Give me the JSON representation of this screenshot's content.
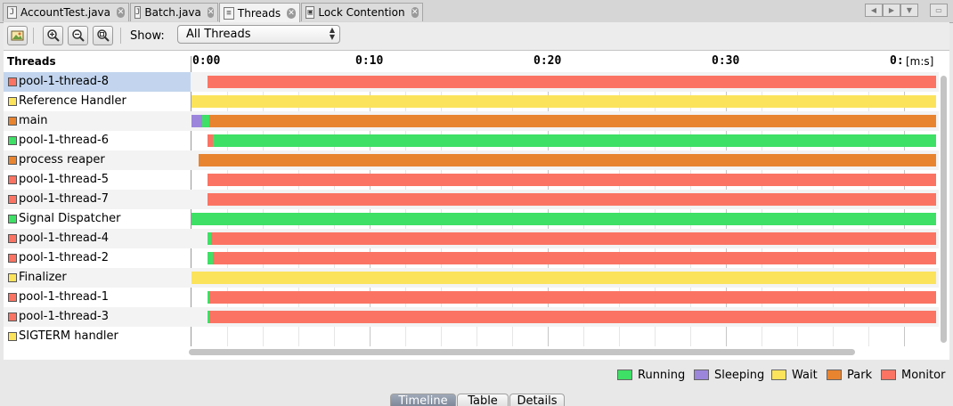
{
  "tabs": [
    {
      "label": "AccountTest.java",
      "icon": "java-file-icon"
    },
    {
      "label": "Batch.java",
      "icon": "java-file-icon"
    },
    {
      "label": "Threads",
      "icon": "threads-icon"
    },
    {
      "label": "Lock Contention",
      "icon": "lock-icon"
    }
  ],
  "toolbar": {
    "show_label": "Show:",
    "show_value": "All Threads"
  },
  "timeline": {
    "header_label": "Threads",
    "ticks": [
      "0:00",
      "0:10",
      "0:20",
      "0:30",
      "0:"
    ],
    "unit": "[m:s]"
  },
  "states": {
    "Running": "#3ee065",
    "Sleeping": "#9b86dc",
    "Wait": "#fbe35c",
    "Park": "#e88430",
    "Monitor": "#fb7463"
  },
  "threads": [
    {
      "name": "pool-1-thread-8",
      "state": "Monitor",
      "selected": true,
      "segments": [
        {
          "state": "Monitor",
          "from": 0.9,
          "to": 41.8
        }
      ]
    },
    {
      "name": "Reference Handler",
      "state": "Wait",
      "segments": [
        {
          "state": "Wait",
          "from": 0.0,
          "to": 41.8
        }
      ]
    },
    {
      "name": "main",
      "state": "Park",
      "segments": [
        {
          "state": "Sleeping",
          "from": 0.0,
          "to": 0.6
        },
        {
          "state": "Running",
          "from": 0.6,
          "to": 1.0
        },
        {
          "state": "Park",
          "from": 1.0,
          "to": 41.8
        }
      ]
    },
    {
      "name": "pool-1-thread-6",
      "state": "Running",
      "segments": [
        {
          "state": "Monitor",
          "from": 0.9,
          "to": 1.2
        },
        {
          "state": "Running",
          "from": 1.2,
          "to": 41.8
        }
      ]
    },
    {
      "name": "process reaper",
      "state": "Park",
      "segments": [
        {
          "state": "Park",
          "from": 0.4,
          "to": 41.8
        }
      ]
    },
    {
      "name": "pool-1-thread-5",
      "state": "Monitor",
      "segments": [
        {
          "state": "Monitor",
          "from": 0.9,
          "to": 41.8
        }
      ]
    },
    {
      "name": "pool-1-thread-7",
      "state": "Monitor",
      "segments": [
        {
          "state": "Monitor",
          "from": 0.9,
          "to": 41.8
        }
      ]
    },
    {
      "name": "Signal Dispatcher",
      "state": "Running",
      "segments": [
        {
          "state": "Running",
          "from": 0.0,
          "to": 41.8
        }
      ]
    },
    {
      "name": "pool-1-thread-4",
      "state": "Monitor",
      "segments": [
        {
          "state": "Running",
          "from": 0.9,
          "to": 1.1
        },
        {
          "state": "Monitor",
          "from": 1.1,
          "to": 41.8
        }
      ]
    },
    {
      "name": "pool-1-thread-2",
      "state": "Monitor",
      "segments": [
        {
          "state": "Running",
          "from": 0.9,
          "to": 1.2
        },
        {
          "state": "Monitor",
          "from": 1.2,
          "to": 41.8
        }
      ]
    },
    {
      "name": "Finalizer",
      "state": "Wait",
      "segments": [
        {
          "state": "Wait",
          "from": 0.0,
          "to": 41.8
        }
      ]
    },
    {
      "name": "pool-1-thread-1",
      "state": "Monitor",
      "segments": [
        {
          "state": "Running",
          "from": 0.9,
          "to": 1.0
        },
        {
          "state": "Monitor",
          "from": 1.0,
          "to": 41.8
        }
      ]
    },
    {
      "name": "pool-1-thread-3",
      "state": "Monitor",
      "segments": [
        {
          "state": "Running",
          "from": 0.9,
          "to": 1.0
        },
        {
          "state": "Monitor",
          "from": 1.0,
          "to": 41.8
        }
      ]
    },
    {
      "name": "SIGTERM handler",
      "state": "Wait",
      "segments": []
    }
  ],
  "legend": [
    "Running",
    "Sleeping",
    "Wait",
    "Park",
    "Monitor"
  ],
  "view_tabs": [
    "Timeline",
    "Table",
    "Details"
  ],
  "active_view_tab": "Timeline"
}
